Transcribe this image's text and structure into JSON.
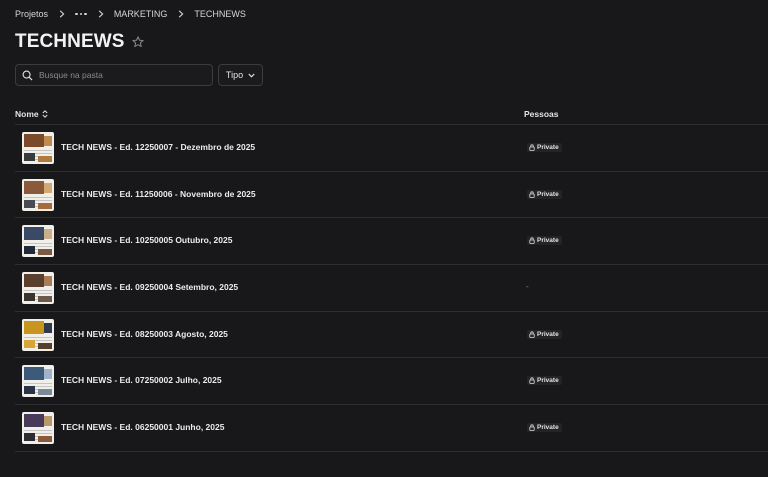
{
  "breadcrumb": {
    "root": "Projetos",
    "more_icon": "more-horizontal-icon",
    "items": [
      "MARKETING",
      "TECHNEWS"
    ]
  },
  "header": {
    "title": "TECHNEWS",
    "favorite_icon": "star-outline-icon"
  },
  "search": {
    "placeholder": "Busque na pasta",
    "value": ""
  },
  "filter": {
    "label": "Tipo"
  },
  "table": {
    "columns": {
      "name": "Nome",
      "people": "Pessoas"
    },
    "rows": [
      {
        "name": "TECH NEWS - Ed. 12250007 - Dezembro de 2025",
        "access": "Private",
        "palette": [
          "#7a4a2a",
          "#c28a4f",
          "#3a3a3a",
          "#b07a3e"
        ]
      },
      {
        "name": "TECH NEWS - Ed. 11250006 - Novembro de 2025",
        "access": "Private",
        "palette": [
          "#8a5a3a",
          "#d3a873",
          "#4a4a52",
          "#a46b3c"
        ]
      },
      {
        "name": "TECH NEWS - Ed. 10250005 Outubro, 2025",
        "access": "Private",
        "palette": [
          "#3a4a66",
          "#c7b08a",
          "#202a3a",
          "#7a5a44"
        ]
      },
      {
        "name": "TECH NEWS - Ed. 09250004 Setembro, 2025",
        "access": "-",
        "palette": [
          "#5a3e2e",
          "#a97d57",
          "#3a3330",
          "#6b5a4c"
        ]
      },
      {
        "name": "TECH NEWS - Ed. 08250003 Agosto, 2025",
        "access": "Private",
        "palette": [
          "#c8961e",
          "#2f3a4c",
          "#d8a43a",
          "#55402a"
        ]
      },
      {
        "name": "TECH NEWS - Ed. 07250002 Julho, 2025",
        "access": "Private",
        "palette": [
          "#3c5a7a",
          "#9fb4c8",
          "#2a3446",
          "#7a8a98"
        ]
      },
      {
        "name": "TECH NEWS - Ed. 06250001 Junho, 2025",
        "access": "Private",
        "palette": [
          "#4a3a5a",
          "#b89a6a",
          "#2c2c34",
          "#8a5a3a"
        ]
      }
    ]
  },
  "icons": {
    "search": "search-icon",
    "chevron": "chevron-right-icon",
    "dropdown": "chevron-down-icon",
    "sort": "sort-icon",
    "lock": "lock-icon"
  },
  "colors": {
    "background": "#18181a",
    "text": "#e8e8ea",
    "divider": "#2e2e32"
  }
}
